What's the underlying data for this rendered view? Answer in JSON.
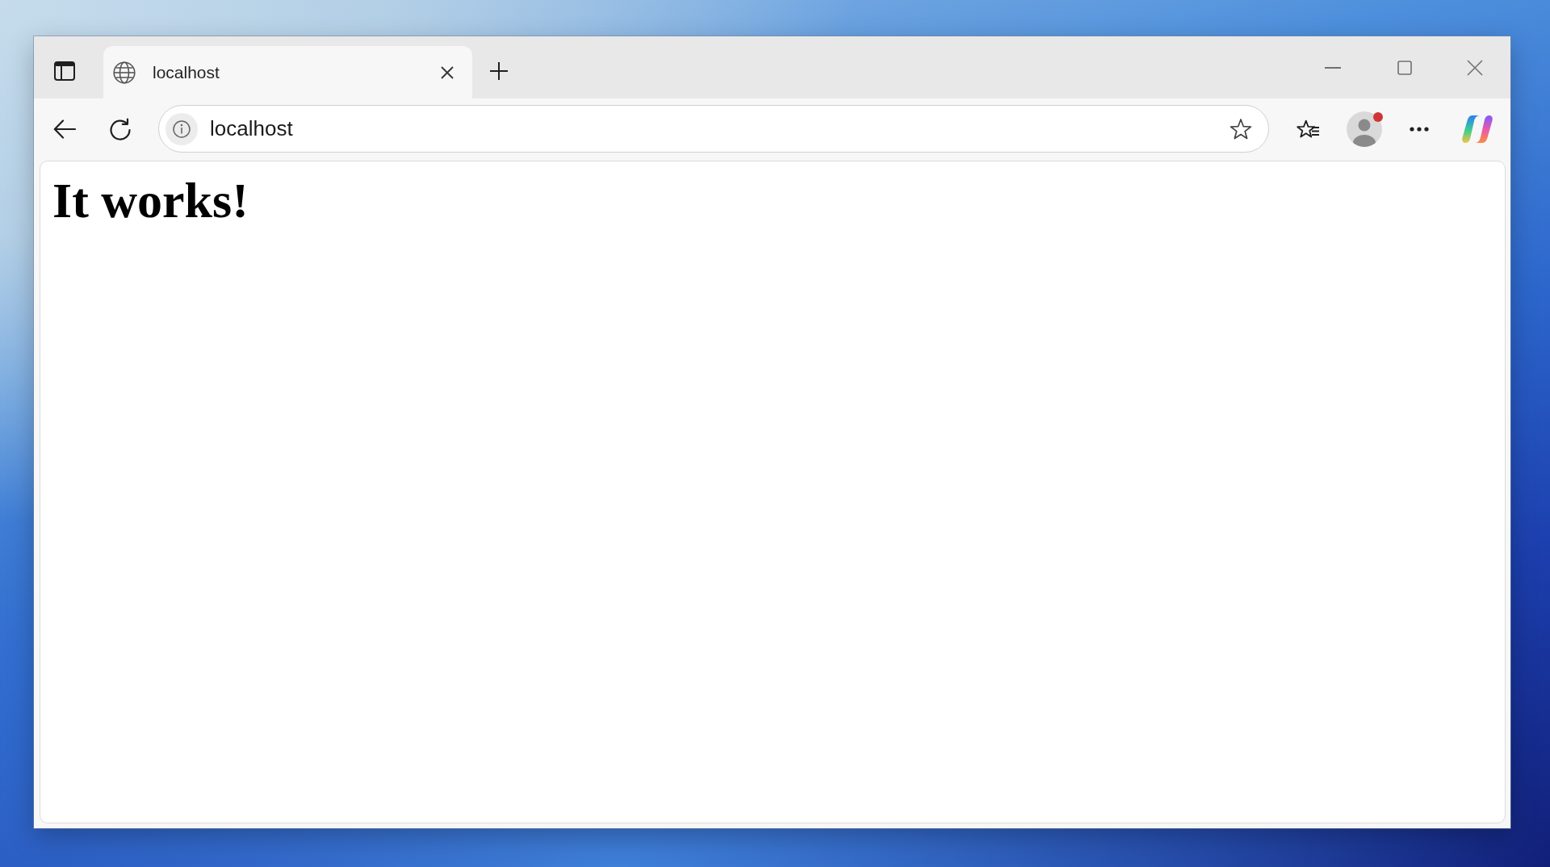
{
  "tabs": [
    {
      "title": "localhost",
      "selected": true
    }
  ],
  "address_bar": {
    "value": "localhost"
  },
  "profile": {
    "notification": true
  },
  "page": {
    "heading": "It works!"
  }
}
